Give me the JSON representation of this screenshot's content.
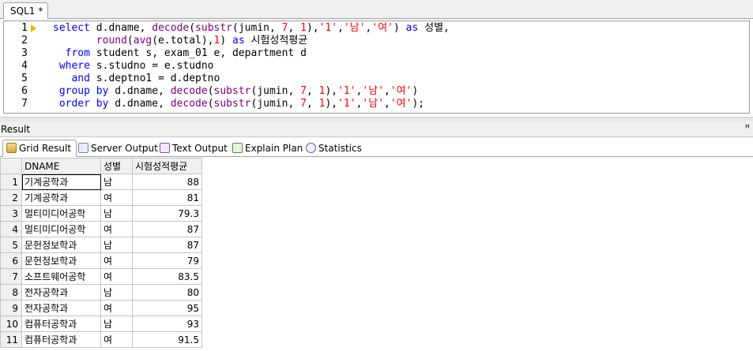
{
  "editor": {
    "tab_label": "SQL1 *",
    "lines": [
      {
        "num": "1",
        "tokens": [
          {
            "t": "select ",
            "c": "kw"
          },
          {
            "t": "d.dname, ",
            "c": "plain"
          },
          {
            "t": "decode",
            "c": "fn"
          },
          {
            "t": "(",
            "c": "plain"
          },
          {
            "t": "substr",
            "c": "fn"
          },
          {
            "t": "(jumin, ",
            "c": "plain"
          },
          {
            "t": "7",
            "c": "num"
          },
          {
            "t": ", ",
            "c": "plain"
          },
          {
            "t": "1",
            "c": "num"
          },
          {
            "t": "),",
            "c": "plain"
          },
          {
            "t": "'1'",
            "c": "str"
          },
          {
            "t": ",",
            "c": "plain"
          },
          {
            "t": "'남'",
            "c": "str"
          },
          {
            "t": ",",
            "c": "plain"
          },
          {
            "t": "'여'",
            "c": "str"
          },
          {
            "t": ") ",
            "c": "plain"
          },
          {
            "t": "as ",
            "c": "kw"
          },
          {
            "t": "성별,",
            "c": "plain"
          }
        ]
      },
      {
        "num": "2",
        "tokens": [
          {
            "t": "       round",
            "c": "fn"
          },
          {
            "t": "(",
            "c": "plain"
          },
          {
            "t": "avg",
            "c": "fn"
          },
          {
            "t": "(e.total),",
            "c": "plain"
          },
          {
            "t": "1",
            "c": "num"
          },
          {
            "t": ") ",
            "c": "plain"
          },
          {
            "t": "as ",
            "c": "kw"
          },
          {
            "t": "시험성적평균",
            "c": "plain"
          }
        ]
      },
      {
        "num": "3",
        "tokens": [
          {
            "t": "  from ",
            "c": "kw"
          },
          {
            "t": "student s, exam_01 e, department d",
            "c": "plain"
          }
        ]
      },
      {
        "num": "4",
        "tokens": [
          {
            "t": " where ",
            "c": "kw"
          },
          {
            "t": "s.studno = e.studno",
            "c": "plain"
          }
        ]
      },
      {
        "num": "5",
        "tokens": [
          {
            "t": "   and ",
            "c": "kw"
          },
          {
            "t": "s.deptno1 = d.deptno",
            "c": "plain"
          }
        ]
      },
      {
        "num": "6",
        "tokens": [
          {
            "t": " group by ",
            "c": "kw"
          },
          {
            "t": "d.dname, ",
            "c": "plain"
          },
          {
            "t": "decode",
            "c": "fn"
          },
          {
            "t": "(",
            "c": "plain"
          },
          {
            "t": "substr",
            "c": "fn"
          },
          {
            "t": "(jumin, ",
            "c": "plain"
          },
          {
            "t": "7",
            "c": "num"
          },
          {
            "t": ", ",
            "c": "plain"
          },
          {
            "t": "1",
            "c": "num"
          },
          {
            "t": "),",
            "c": "plain"
          },
          {
            "t": "'1'",
            "c": "str"
          },
          {
            "t": ",",
            "c": "plain"
          },
          {
            "t": "'남'",
            "c": "str"
          },
          {
            "t": ",",
            "c": "plain"
          },
          {
            "t": "'여'",
            "c": "str"
          },
          {
            "t": ")",
            "c": "plain"
          }
        ]
      },
      {
        "num": "7",
        "tokens": [
          {
            "t": " order by ",
            "c": "kw"
          },
          {
            "t": "d.dname, ",
            "c": "plain"
          },
          {
            "t": "decode",
            "c": "fn"
          },
          {
            "t": "(",
            "c": "plain"
          },
          {
            "t": "substr",
            "c": "fn"
          },
          {
            "t": "(jumin, ",
            "c": "plain"
          },
          {
            "t": "7",
            "c": "num"
          },
          {
            "t": ", ",
            "c": "plain"
          },
          {
            "t": "1",
            "c": "num"
          },
          {
            "t": "),",
            "c": "plain"
          },
          {
            "t": "'1'",
            "c": "str"
          },
          {
            "t": ",",
            "c": "plain"
          },
          {
            "t": "'남'",
            "c": "str"
          },
          {
            "t": ",",
            "c": "plain"
          },
          {
            "t": "'여'",
            "c": "str"
          },
          {
            "t": ");",
            "c": "plain"
          }
        ]
      }
    ]
  },
  "result": {
    "title": "Result",
    "pin": "ꟸ",
    "tabs": [
      {
        "label": "Grid Result",
        "icon": "grid-icon"
      },
      {
        "label": "Server Output",
        "icon": "server-output-icon"
      },
      {
        "label": "Text Output",
        "icon": "text-output-icon"
      },
      {
        "label": "Explain Plan",
        "icon": "explain-plan-icon"
      },
      {
        "label": "Statistics",
        "icon": "statistics-icon"
      }
    ],
    "columns": [
      "DNAME",
      "성별",
      "시험성적평균"
    ],
    "rows": [
      {
        "n": "1",
        "dname": "기계공학과",
        "gender": "남",
        "avg": "88"
      },
      {
        "n": "2",
        "dname": "기계공학과",
        "gender": "여",
        "avg": "81"
      },
      {
        "n": "3",
        "dname": "멀티미디어공학",
        "gender": "남",
        "avg": "79.3"
      },
      {
        "n": "4",
        "dname": "멀티미디어공학",
        "gender": "여",
        "avg": "87"
      },
      {
        "n": "5",
        "dname": "문헌정보학과",
        "gender": "남",
        "avg": "87"
      },
      {
        "n": "6",
        "dname": "문헌정보학과",
        "gender": "여",
        "avg": "79"
      },
      {
        "n": "7",
        "dname": "소프트웨어공학",
        "gender": "여",
        "avg": "83.5"
      },
      {
        "n": "8",
        "dname": "전자공학과",
        "gender": "남",
        "avg": "80"
      },
      {
        "n": "9",
        "dname": "전자공학과",
        "gender": "여",
        "avg": "95"
      },
      {
        "n": "10",
        "dname": "컴퓨터공학과",
        "gender": "남",
        "avg": "93"
      },
      {
        "n": "11",
        "dname": "컴퓨터공학과",
        "gender": "여",
        "avg": "91.5"
      }
    ]
  }
}
